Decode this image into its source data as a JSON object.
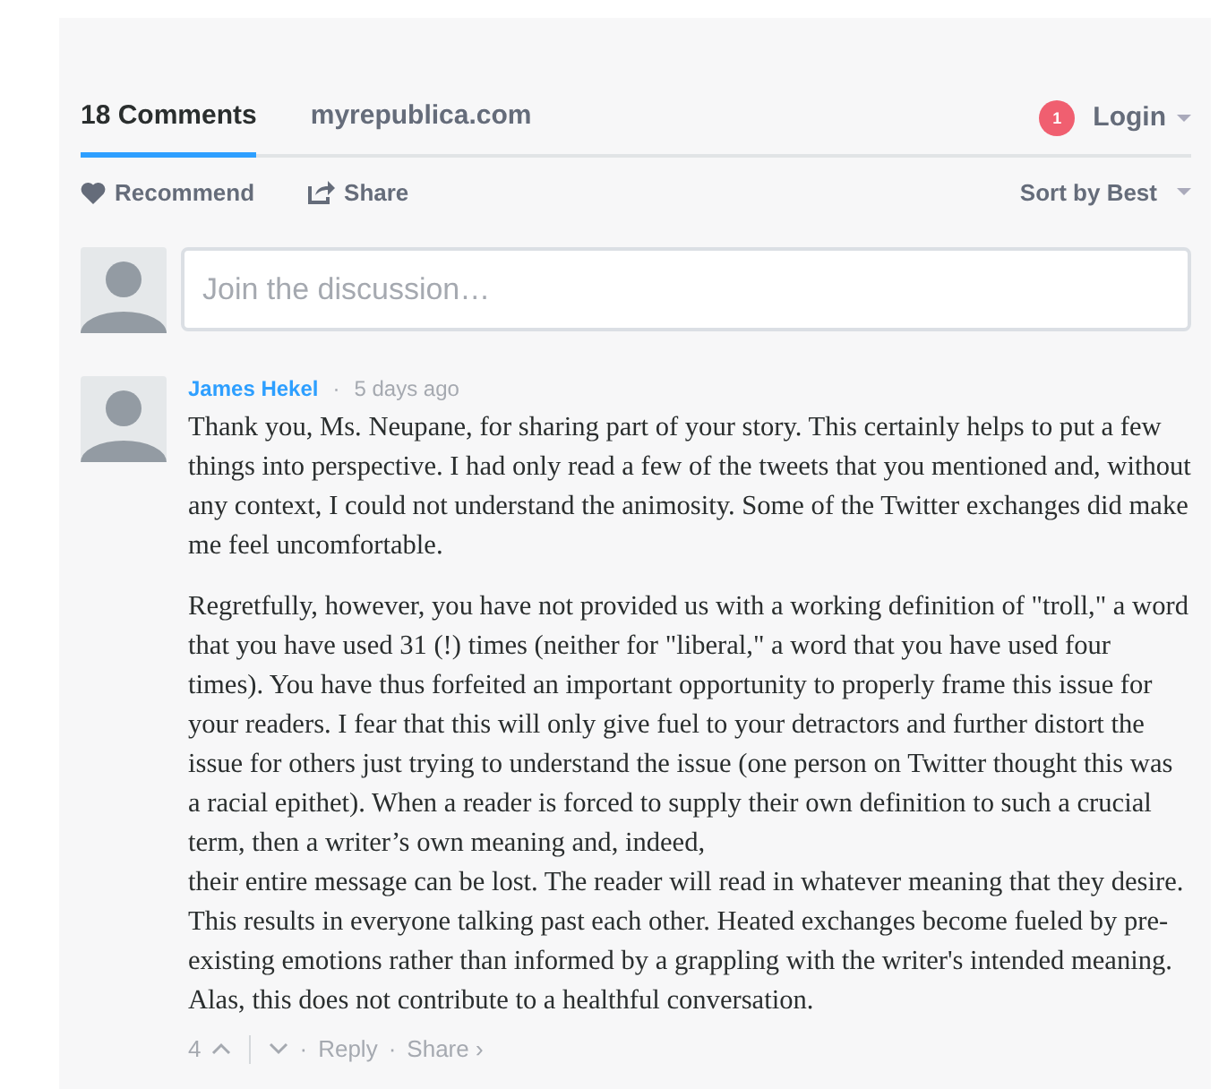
{
  "tabs": [
    {
      "label": "18 Comments",
      "selected": true
    },
    {
      "label": "myrepublica.com",
      "selected": false
    }
  ],
  "notification": {
    "count": "1"
  },
  "login": {
    "label": "Login"
  },
  "actions": {
    "recommend": "Recommend",
    "share": "Share",
    "sort": "Sort by Best"
  },
  "composer": {
    "placeholder": "Join the discussion…"
  },
  "comments": [
    {
      "author": "James Hekel",
      "separator": "·",
      "time": "5 days ago",
      "paragraphs": [
        "Thank you, Ms. Neupane, for sharing part of your story. This certainly helps to put a few things into perspective. I had only read a few of the tweets that you mentioned and, without any context, I could not understand the animosity. Some of the Twitter exchanges did make me feel uncomfortable.",
        "Regretfully, however, you have not provided us with a working definition of \"troll,\" a word that you have used 31 (!) times (neither for \"liberal,\" a word that you have used four times). You have thus forfeited an important opportunity to properly frame this issue for your readers. I fear that this will only give fuel to your detractors and further distort the issue for others just trying to understand the issue (one person on Twitter thought this was a racial epithet). When a reader is forced to supply their own definition to such a crucial term, then a writer’s own meaning and, indeed,\ntheir entire message can be lost. The reader will read in whatever meaning that they desire. This results in everyone talking past each other. Heated exchanges become fueled by pre-existing emotions rather than informed by a grappling with the writer's intended meaning. Alas, this does not contribute to a healthful conversation."
      ],
      "votes": "4",
      "reply": "Reply",
      "share": "Share ›",
      "footer_separator": "·"
    }
  ]
}
